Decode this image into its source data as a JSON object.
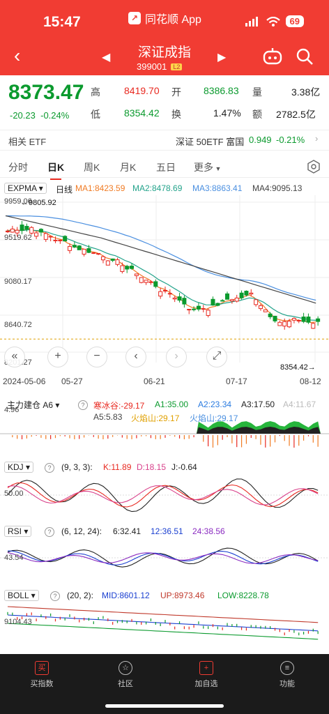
{
  "status": {
    "time": "15:47",
    "app_name": "同花顺 App",
    "battery": "69"
  },
  "header": {
    "title": "深证成指",
    "code": "399001",
    "level": "L2",
    "color": "#f13c33"
  },
  "quote": {
    "price": "8373.47",
    "change": "-20.23",
    "change_pct": "-0.24%",
    "high_label": "高",
    "high": "8419.70",
    "open_label": "开",
    "open": "8386.83",
    "vol_label": "量",
    "volume": "3.38亿",
    "low_label": "低",
    "low": "8354.42",
    "turn_label": "换",
    "turnover_rate": "1.47%",
    "amt_label": "额",
    "amount": "2782.5亿"
  },
  "etf": {
    "label": "相关 ETF",
    "name": "深证 50ETF 富国",
    "price": "0.949",
    "pct": "-0.21%"
  },
  "tabs": [
    {
      "label": "分时"
    },
    {
      "label": "日K"
    },
    {
      "label": "周K"
    },
    {
      "label": "月K"
    },
    {
      "label": "五日"
    },
    {
      "label": "更多"
    }
  ],
  "main_chart": {
    "indicator": "EXPMA",
    "line_label": "日线",
    "ma1": "MA1:8423.59",
    "ma2": "MA2:8478.69",
    "ma3": "MA3:8863.41",
    "ma4": "MA4:9095.13",
    "y_labels": [
      "9959.06",
      "9519.62",
      "9080.17",
      "8640.72",
      "8201.27"
    ],
    "max_marker": "9805.92",
    "last_marker": "8354.42",
    "dates": [
      "2024-05-06",
      "05-27",
      "06-21",
      "07-17",
      "08-12"
    ],
    "colors": {
      "up": "#e8281f",
      "down": "#0b9a2e",
      "ma1": "#f07b24",
      "ma2": "#23a38b",
      "ma3": "#4a8fe0",
      "ma4": "#444444"
    }
  },
  "zhuli": {
    "name": "主力建仓 A6",
    "v1": "寒冰谷:-29.17",
    "v2": "A1:35.00",
    "v3": "A2:23.34",
    "v4": "A3:17.50",
    "v5": "A4:11.67",
    "v6": "A5:5.83",
    "v7": "火焰山:29.17",
    "v8": "火焰山:29.17",
    "y": "4.96"
  },
  "kdj": {
    "name": "KDJ",
    "params": "(9, 3, 3):",
    "k": "K:11.89",
    "d": "D:18.15",
    "j": "J:-0.64",
    "y": "50.00"
  },
  "rsi": {
    "name": "RSI",
    "params": "(6, 12, 24):",
    "r6": "6:32.41",
    "r12": "12:36.51",
    "r24": "24:38.56",
    "y": "43.54"
  },
  "boll": {
    "name": "BOLL",
    "params": "(20, 2):",
    "mid": "MID:8601.12",
    "up": "UP:8973.46",
    "low": "LOW:8228.78",
    "y": "9104.43"
  },
  "nav": [
    {
      "label": "买指数",
      "icon": "buy-icon"
    },
    {
      "label": "社区",
      "icon": "community-icon"
    },
    {
      "label": "加自选",
      "icon": "add-favorite-icon"
    },
    {
      "label": "功能",
      "icon": "menu-icon"
    }
  ]
}
